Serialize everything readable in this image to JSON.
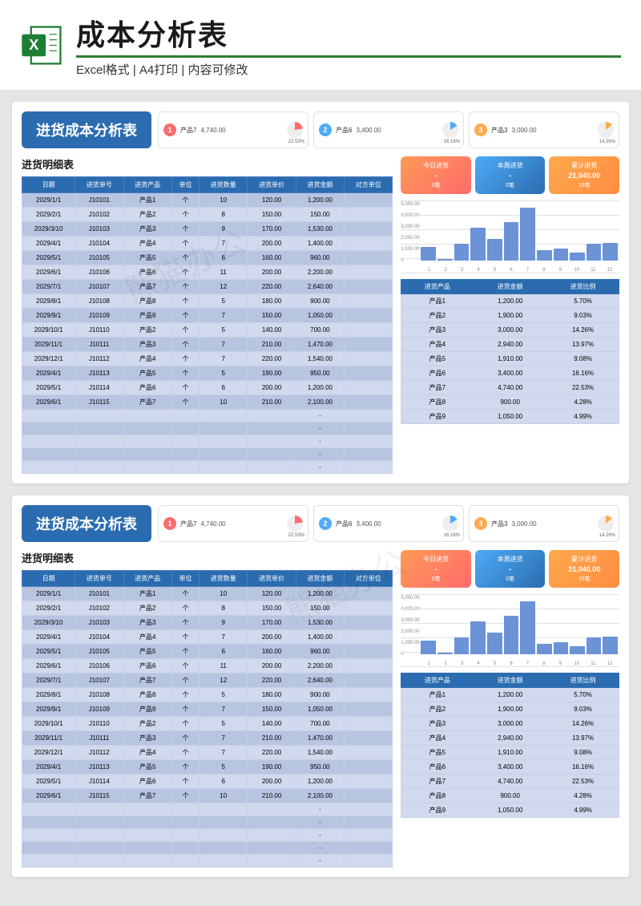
{
  "header": {
    "title": "成本分析表",
    "subtitle": "Excel格式 | A4打印 | 内容可修改"
  },
  "sheet_title": "进货成本分析表",
  "top_ranks": [
    {
      "rank": "1",
      "product": "产品7",
      "amount": "4,740.00",
      "pct": "22.53%"
    },
    {
      "rank": "2",
      "product": "产品6",
      "amount": "3,400.00",
      "pct": "16.16%"
    },
    {
      "rank": "3",
      "product": "产品3",
      "amount": "3,000.00",
      "pct": "14.26%"
    }
  ],
  "detail_title": "进货明细表",
  "detail_headers": [
    "日期",
    "进货单号",
    "进货产品",
    "单位",
    "进货数量",
    "进货单价",
    "进货金额",
    "对方单位"
  ],
  "detail_rows": [
    [
      "2029/1/1",
      "J10101",
      "产品1",
      "个",
      "10",
      "120.00",
      "1,200.00",
      ""
    ],
    [
      "2029/2/1",
      "J10102",
      "产品2",
      "个",
      "8",
      "150.00",
      "150.00",
      ""
    ],
    [
      "2029/3/10",
      "J10103",
      "产品3",
      "个",
      "9",
      "170.00",
      "1,530.00",
      ""
    ],
    [
      "2029/4/1",
      "J10104",
      "产品4",
      "个",
      "7",
      "200.00",
      "1,400.00",
      ""
    ],
    [
      "2029/5/1",
      "J10105",
      "产品5",
      "个",
      "6",
      "160.00",
      "960.00",
      ""
    ],
    [
      "2029/6/1",
      "J10106",
      "产品6",
      "个",
      "11",
      "200.00",
      "2,200.00",
      ""
    ],
    [
      "2029/7/1",
      "J10107",
      "产品7",
      "个",
      "12",
      "220.00",
      "2,640.00",
      ""
    ],
    [
      "2029/8/1",
      "J10108",
      "产品8",
      "个",
      "5",
      "180.00",
      "900.00",
      ""
    ],
    [
      "2029/9/1",
      "J10109",
      "产品9",
      "个",
      "7",
      "150.00",
      "1,050.00",
      ""
    ],
    [
      "2029/10/1",
      "J10110",
      "产品2",
      "个",
      "5",
      "140.00",
      "700.00",
      ""
    ],
    [
      "2029/11/1",
      "J10111",
      "产品3",
      "个",
      "7",
      "210.00",
      "1,470.00",
      ""
    ],
    [
      "2029/12/1",
      "J10112",
      "产品4",
      "个",
      "7",
      "220.00",
      "1,540.00",
      ""
    ],
    [
      "2029/4/1",
      "J10113",
      "产品5",
      "个",
      "5",
      "190.00",
      "950.00",
      ""
    ],
    [
      "2029/5/1",
      "J10114",
      "产品6",
      "个",
      "6",
      "200.00",
      "1,200.00",
      ""
    ],
    [
      "2029/6/1",
      "J10115",
      "产品7",
      "个",
      "10",
      "210.00",
      "2,100.00",
      ""
    ]
  ],
  "stat_cards": [
    {
      "label": "今日进货",
      "value": "-",
      "sub": "0笔"
    },
    {
      "label": "本周进货",
      "value": "-",
      "sub": "0笔"
    },
    {
      "label": "累计进货",
      "value": "21,040.00",
      "sub": "15笔"
    }
  ],
  "chart_data": {
    "type": "bar",
    "categories": [
      "1",
      "2",
      "3",
      "4",
      "5",
      "6",
      "7",
      "8",
      "9",
      "10",
      "11",
      "12"
    ],
    "values": [
      1200,
      150,
      1530,
      2940,
      1910,
      3400,
      4740,
      900,
      1050,
      700,
      1470,
      1540
    ],
    "ylabel": "",
    "ylim": [
      0,
      5000
    ],
    "y_ticks": [
      "0",
      "1,000.00",
      "2,000.00",
      "3,000.00",
      "4,000.00",
      "5,000.00"
    ]
  },
  "summary_headers": [
    "进货产品",
    "进货金额",
    "进货比例"
  ],
  "summary_rows": [
    [
      "产品1",
      "1,200.00",
      "5.70%"
    ],
    [
      "产品2",
      "1,900.00",
      "9.03%"
    ],
    [
      "产品3",
      "3,000.00",
      "14.26%"
    ],
    [
      "产品4",
      "2,940.00",
      "13.97%"
    ],
    [
      "产品5",
      "1,910.00",
      "9.08%"
    ],
    [
      "产品6",
      "3,400.00",
      "16.16%"
    ],
    [
      "产品7",
      "4,740.00",
      "22.53%"
    ],
    [
      "产品8",
      "900.00",
      "4.28%"
    ],
    [
      "产品9",
      "1,050.00",
      "4.99%"
    ]
  ],
  "watermark": "熊猫办公"
}
